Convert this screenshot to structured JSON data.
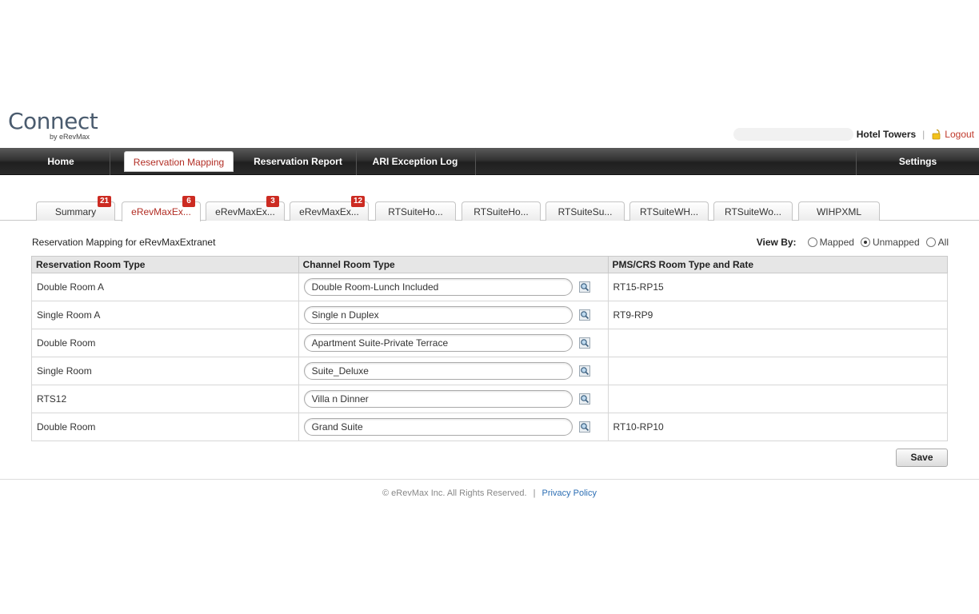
{
  "logo": {
    "main": "Connect",
    "sub": "by eRevMax"
  },
  "header": {
    "hotel": "Hotel Towers",
    "separator": "|",
    "logout": "Logout"
  },
  "nav": {
    "home": "Home",
    "reservation_mapping": "Reservation Mapping",
    "reservation_report": "Reservation Report",
    "ari_exception_log": "ARI Exception Log",
    "settings": "Settings"
  },
  "tabs": [
    {
      "label": "Summary",
      "badge": "21"
    },
    {
      "label": "eRevMaxEx...",
      "badge": "6"
    },
    {
      "label": "eRevMaxEx...",
      "badge": "3"
    },
    {
      "label": "eRevMaxEx...",
      "badge": "12"
    },
    {
      "label": "RTSuiteHo..."
    },
    {
      "label": "RTSuiteHo..."
    },
    {
      "label": "RTSuiteSu..."
    },
    {
      "label": "RTSuiteWH..."
    },
    {
      "label": "RTSuiteWo..."
    },
    {
      "label": "WIHPXML"
    }
  ],
  "section_title": "Reservation Mapping for eRevMaxExtranet",
  "view_by": {
    "label": "View By:",
    "mapped": "Mapped",
    "unmapped": "Unmapped",
    "all": "All",
    "selected": "Unmapped"
  },
  "table": {
    "headers": [
      "Reservation Room Type",
      "Channel Room Type",
      "PMS/CRS Room Type and Rate"
    ],
    "rows": [
      {
        "reservation": "Double Room A",
        "channel": "Double Room-Lunch Included",
        "pms": "RT15-RP15"
      },
      {
        "reservation": "Single Room A",
        "channel": "Single n Duplex",
        "pms": "RT9-RP9"
      },
      {
        "reservation": "Double Room",
        "channel": "Apartment Suite-Private Terrace",
        "pms": ""
      },
      {
        "reservation": "Single Room",
        "channel": "Suite_Deluxe",
        "pms": ""
      },
      {
        "reservation": "RTS12",
        "channel": "Villa n Dinner",
        "pms": ""
      },
      {
        "reservation": "Double Room",
        "channel": "Grand Suite",
        "pms": "RT10-RP10"
      }
    ]
  },
  "save_label": "Save",
  "footer": {
    "copyright": "© eRevMax Inc. All Rights Reserved.",
    "separator": "|",
    "privacy": "Privacy Policy"
  }
}
